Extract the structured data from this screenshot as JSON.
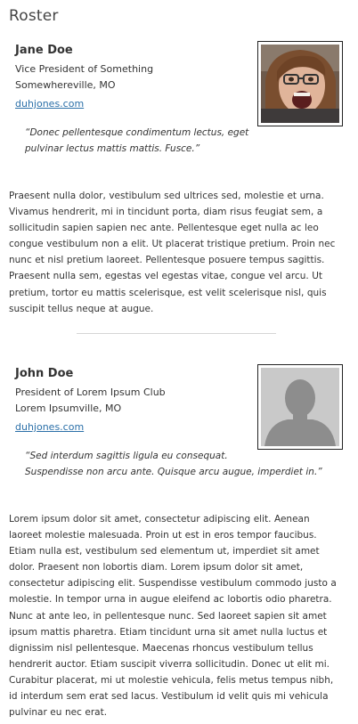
{
  "page": {
    "title": "Roster"
  },
  "people": [
    {
      "name": "Jane Doe",
      "title": "Vice President of Something",
      "location": "Somewhereville, MO",
      "link": "duhjones.com",
      "photo": "woman-photo-icon",
      "quote_line1": "“Donec pellentesque condimentum lectus, eget",
      "quote_line2": "pulvinar lectus mattis mattis. Fusce.”",
      "bio": "Praesent nulla dolor, vestibulum sed ultrices sed, molestie et urna. Vivamus hendrerit, mi in tincidunt porta, diam risus feugiat sem, a sollicitudin sapien sapien nec ante. Pellentesque eget nulla ac leo congue vestibulum non a elit. Ut placerat tristique pretium. Proin nec nunc et nisl pretium laoreet. Pellentesque posuere tempus sagittis. Praesent nulla sem, egestas vel egestas vitae, congue vel arcu. Ut pretium, tortor eu mattis scelerisque, est velit scelerisque nisl, quis suscipit tellus neque at augue."
    },
    {
      "name": "John Doe",
      "title": "President of Lorem Ipsum Club",
      "location": "Lorem Ipsumville, MO",
      "link": "duhjones.com",
      "photo": "placeholder-avatar-icon",
      "quote_line1": "“Sed interdum sagittis ligula eu consequat.",
      "quote_line2": "Suspendisse non arcu ante. Quisque arcu augue, imperdiet in.”",
      "bio": "Lorem ipsum dolor sit amet, consectetur adipiscing elit. Aenean laoreet molestie malesuada. Proin ut est in eros tempor faucibus. Etiam nulla est, vestibulum sed elementum ut, imperdiet sit amet dolor. Praesent non lobortis diam. Lorem ipsum dolor sit amet, consectetur adipiscing elit. Suspendisse vestibulum commodo justo a molestie. In tempor urna in augue eleifend ac lobortis odio pharetra. Nunc at ante leo, in pellentesque nunc. Sed laoreet sapien sit amet ipsum mattis pharetra. Etiam tincidunt urna sit amet nulla luctus et dignissim nisl pellentesque. Maecenas rhoncus vestibulum tellus hendrerit auctor. Etiam suscipit viverra sollicitudin. Donec ut elit mi. Curabitur placerat, mi ut molestie vehicula, felis metus tempus nibh, id interdum sem erat sed lacus. Vestibulum id velit quis mi vehicula pulvinar eu nec erat."
    }
  ]
}
